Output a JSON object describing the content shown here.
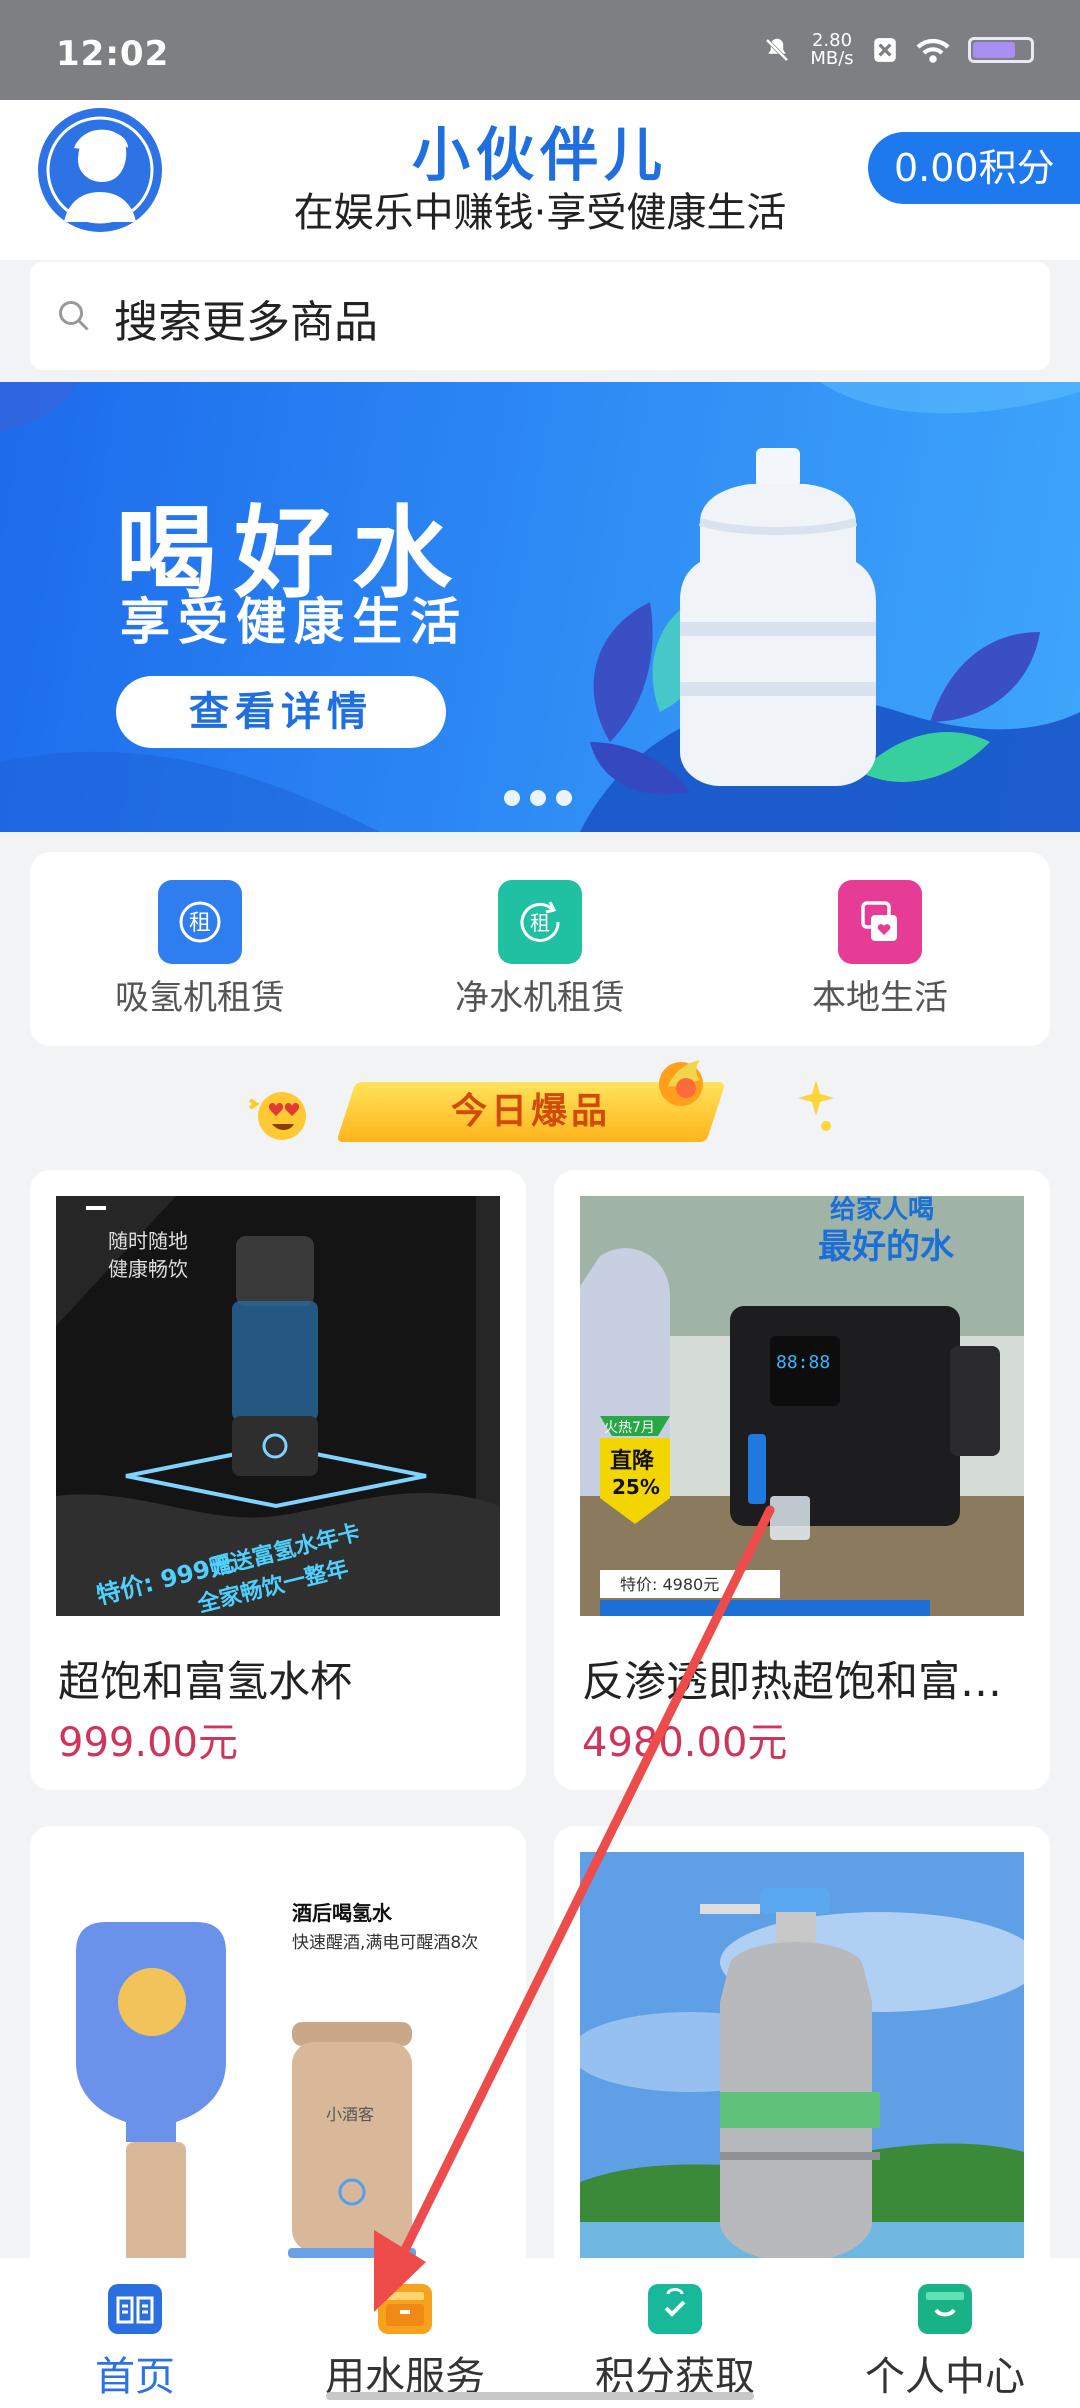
{
  "status_bar": {
    "time": "12:02",
    "net_speed_value": "2.80",
    "net_speed_unit": "MB/s",
    "battery_level": 0.7,
    "icons": [
      "mute-icon",
      "no-sim-icon",
      "wifi-icon",
      "battery-icon"
    ]
  },
  "header": {
    "app_title": "小伙伴儿",
    "subtitle": "在娱乐中赚钱·享受健康生活",
    "points": "0.00积分"
  },
  "search": {
    "placeholder": "搜索更多商品"
  },
  "banner": {
    "title": "喝好水",
    "subtitle": "享受健康生活",
    "button": "查看详情",
    "pages": 3,
    "current_page": 1
  },
  "categories": [
    {
      "label": "吸氢机租赁",
      "icon_char": "租",
      "color": "#2f7ef0",
      "icon": "rent-icon"
    },
    {
      "label": "净水机租赁",
      "icon_char": "租",
      "color": "#20c0a3",
      "icon": "rent-refresh-icon"
    },
    {
      "label": "本地生活",
      "icon_char": "",
      "color": "#e63c95",
      "icon": "local-life-icon"
    }
  ],
  "hot_section": {
    "label": "今日爆品"
  },
  "products": [
    {
      "name": "超饱和富氢水杯",
      "price": "999.00元",
      "img_text_1": "随时随地",
      "img_text_2": "健康畅饮",
      "img_promo_1": "特价: 999元",
      "img_promo_2": "赠送富氢水年卡",
      "img_promo_3": "全家畅饮一整年"
    },
    {
      "name": "反渗透即热超饱和富…",
      "price": "4980.00元",
      "img_text_1": "给家人喝",
      "img_text_2": "最好的水",
      "img_promo_1": "火热7月",
      "img_promo_2": "直降",
      "img_promo_3": "25%",
      "img_promo_4": "特价: 4980元"
    },
    {
      "name": "",
      "price": "",
      "img_text_1": "酒后喝氢水",
      "img_text_2": "快速醒酒,满电可醒酒8次",
      "img_promo_1": "小酒客"
    },
    {
      "name": "",
      "price": "",
      "img_text_1": ""
    }
  ],
  "bottom_nav": [
    {
      "label": "首页",
      "color": "#2a6fe0",
      "icon": "home-book-icon",
      "active": true
    },
    {
      "label": "用水服务",
      "color": "#f6a21c",
      "icon": "water-service-icon",
      "active": false
    },
    {
      "label": "积分获取",
      "color": "#18b89a",
      "icon": "points-bag-icon",
      "active": false
    },
    {
      "label": "个人中心",
      "color": "#19b286",
      "icon": "profile-basket-icon",
      "active": false
    }
  ],
  "colors": {
    "brand_blue": "#1f6fe0",
    "price_red": "#d1345b",
    "annotation_arrow": "#ee4b4b"
  }
}
